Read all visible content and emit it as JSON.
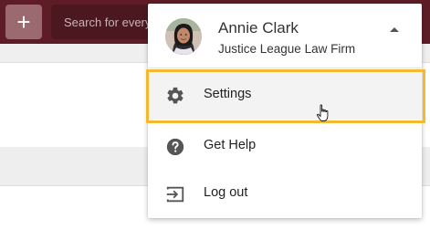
{
  "topbar": {
    "add_icon": "plus-icon",
    "add_symbol": "+",
    "search_placeholder": "Search for every",
    "colors": {
      "bar": "#5e1d26",
      "button": "#9b6a70"
    }
  },
  "account_menu": {
    "user_name": "Annie Clark",
    "organization": "Justice League Law Firm",
    "caret_icon": "caret-up-icon",
    "items": [
      {
        "label": "Settings",
        "icon": "gear-icon",
        "highlighted": true
      },
      {
        "label": "Get Help",
        "icon": "help-circle-icon"
      },
      {
        "label": "Log out",
        "icon": "logout-icon"
      }
    ],
    "highlight_color": "#f5b82e"
  },
  "cursor": {
    "icon": "hand-pointer-icon"
  }
}
